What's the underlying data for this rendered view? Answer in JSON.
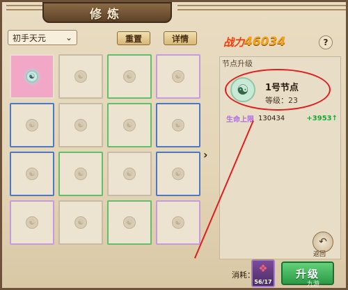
{
  "header": {
    "title": "修炼"
  },
  "left_panel": {
    "realm_select": {
      "value": "初手天元"
    },
    "reset_label": "重置",
    "details_label": "详情",
    "grid": [
      {
        "border": "c-none",
        "active": true
      },
      {
        "border": "c-none",
        "active": false
      },
      {
        "border": "c-green",
        "active": false
      },
      {
        "border": "c-pink",
        "active": false
      },
      {
        "border": "c-blue",
        "active": false
      },
      {
        "border": "c-none",
        "active": false
      },
      {
        "border": "c-green",
        "active": false
      },
      {
        "border": "c-blue",
        "active": false
      },
      {
        "border": "c-blue",
        "active": false
      },
      {
        "border": "c-green",
        "active": false
      },
      {
        "border": "c-none",
        "active": false
      },
      {
        "border": "c-blue",
        "active": false
      },
      {
        "border": "c-pink",
        "active": false
      },
      {
        "border": "c-none",
        "active": false
      },
      {
        "border": "c-green",
        "active": false
      },
      {
        "border": "c-pink",
        "active": false
      }
    ]
  },
  "right_panel": {
    "power_label": "战力",
    "power_value": "46034",
    "help_label": "?",
    "section_title": "节点升级",
    "node_name": "1号节点",
    "node_level_label": "等级：23",
    "stat_name": "生命上限",
    "stat_value": "130434",
    "stat_increase": "+3953↑",
    "back_label": "返回",
    "consume_label": "消耗：",
    "item_count": "56/17",
    "upgrade_label": "升级"
  },
  "watermark": "九游"
}
